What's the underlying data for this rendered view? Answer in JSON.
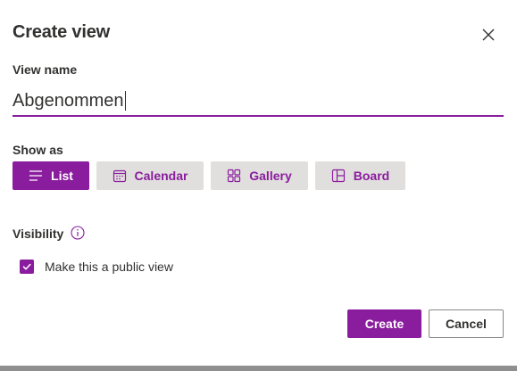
{
  "dialog": {
    "title": "Create view",
    "close_icon": "close-icon"
  },
  "view_name": {
    "label": "View name",
    "value": "Abgenommen"
  },
  "show_as": {
    "label": "Show as",
    "options": [
      {
        "label": "List",
        "icon": "list-icon",
        "selected": true
      },
      {
        "label": "Calendar",
        "icon": "calendar-icon",
        "selected": false
      },
      {
        "label": "Gallery",
        "icon": "gallery-icon",
        "selected": false
      },
      {
        "label": "Board",
        "icon": "board-icon",
        "selected": false
      }
    ]
  },
  "visibility": {
    "label": "Visibility",
    "info_icon": "info-icon",
    "public_checkbox": {
      "label": "Make this a public view",
      "checked": true
    }
  },
  "actions": {
    "create_label": "Create",
    "cancel_label": "Cancel"
  },
  "colors": {
    "accent": "#8a1c9e",
    "button_neutral": "#e1dfdd",
    "text": "#323130"
  }
}
